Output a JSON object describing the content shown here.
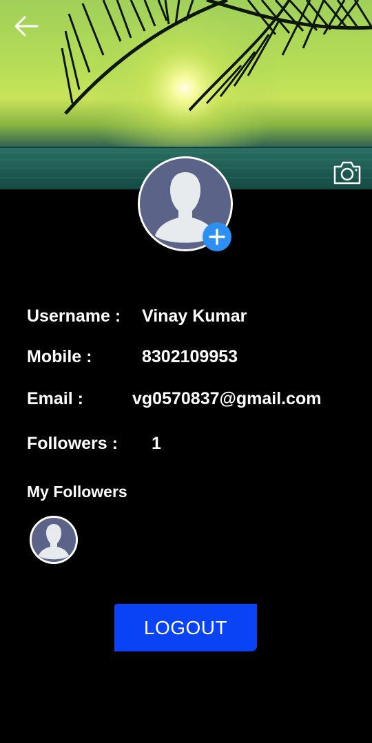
{
  "header": {
    "back_icon": "arrow-left-icon",
    "camera_icon": "camera-icon"
  },
  "profile": {
    "avatar_icon": "person-silhouette-icon",
    "add_photo_icon": "plus-icon"
  },
  "info": {
    "username_label": "Username :",
    "username_value": "Vinay Kumar",
    "mobile_label": "Mobile :",
    "mobile_value": "8302109953",
    "email_label": "Email :",
    "email_value": "vg0570837@gmail.com",
    "followers_label": "Followers :",
    "followers_value": "1"
  },
  "followers": {
    "heading": "My Followers",
    "items": [
      {
        "avatar_icon": "person-silhouette-icon"
      }
    ]
  },
  "actions": {
    "logout_label": "LOGOUT"
  },
  "colors": {
    "background": "#000000",
    "accent_blue": "#0a43f5",
    "add_button_blue": "#2e8ff3",
    "avatar_bg": "#5b6388"
  }
}
